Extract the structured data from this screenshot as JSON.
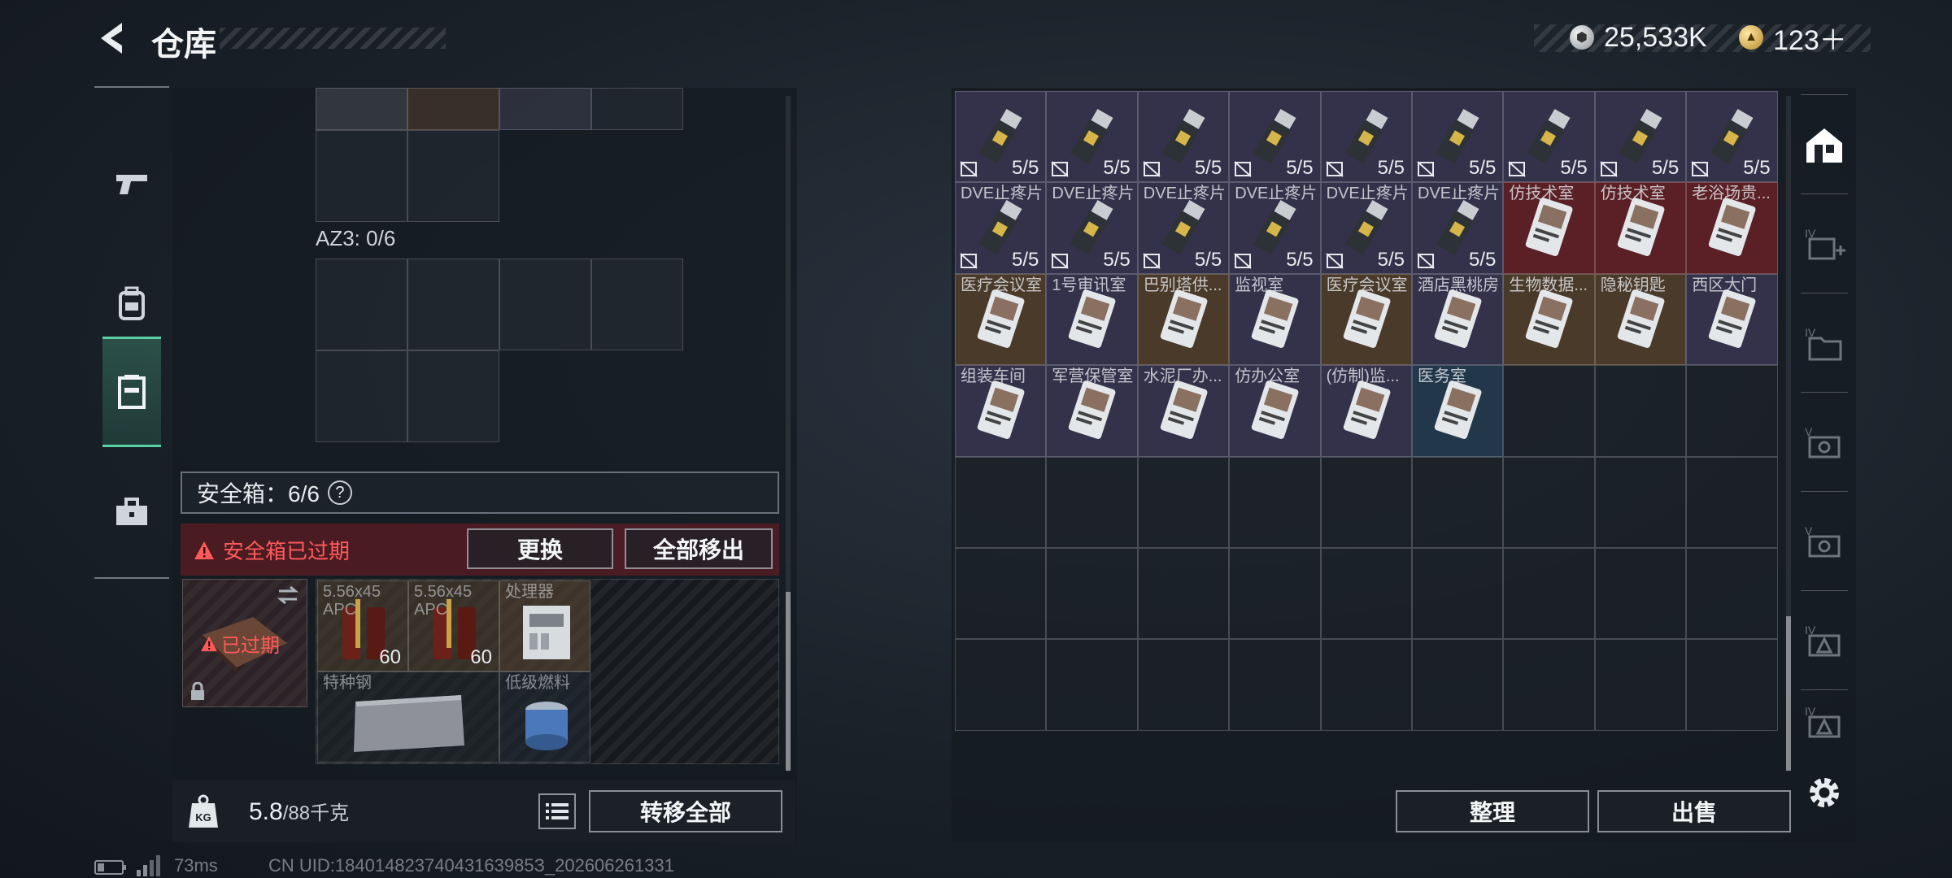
{
  "header": {
    "title": "仓库",
    "currency": [
      {
        "icon": "silver-coin-icon",
        "value": "25,533K"
      },
      {
        "icon": "gold-coin-icon",
        "value": "123＋"
      }
    ]
  },
  "left": {
    "az_label": "AZ3: 0/6",
    "safebox_label": "安全箱：6/6",
    "safebox_help": "?",
    "expired_notice": "安全箱已过期",
    "replace_button": "更换",
    "remove_all_button": "全部移出",
    "case_status": "已过期",
    "safe_items": [
      {
        "name": "5.56x45 APC",
        "qty": "60"
      },
      {
        "name": "5.56x45 APC",
        "qty": "60"
      },
      {
        "name": "处理器",
        "qty": ""
      },
      {
        "name": "特种钢",
        "qty": ""
      },
      {
        "name": "低级燃料",
        "qty": ""
      }
    ],
    "weight_value": "5.8",
    "weight_capacity": "/88千克",
    "weight_icon_label": "KG",
    "transfer_all_button": "转移全部"
  },
  "right": {
    "stack_items_row1": [
      "5/5",
      "5/5",
      "5/5",
      "5/5",
      "5/5",
      "5/5",
      "5/5",
      "5/5",
      "5/5"
    ],
    "stack_items_row2": [
      {
        "name": "DVE止疼片",
        "qty": "5/5"
      },
      {
        "name": "DVE止疼片",
        "qty": "5/5"
      },
      {
        "name": "DVE止疼片",
        "qty": "5/5"
      },
      {
        "name": "DVE止疼片",
        "qty": "5/5"
      },
      {
        "name": "DVE止疼片",
        "qty": "5/5"
      },
      {
        "name": "DVE止疼片",
        "qty": "5/5"
      },
      {
        "name": "仿技术室",
        "qty": ""
      },
      {
        "name": "仿技术室",
        "qty": ""
      },
      {
        "name": "老浴场贵...",
        "qty": ""
      }
    ],
    "key_row3": [
      "医疗会议室",
      "1号审讯室",
      "巴别塔供...",
      "监视室",
      "医疗会议室",
      "酒店黑桃房",
      "生物数据...",
      "隐秘钥匙",
      "西区大门"
    ],
    "key_row4": [
      "组装车间",
      "军营保管室",
      "水泥厂办...",
      "仿办公室",
      "(仿制)监...",
      "医务室"
    ],
    "sort_button": "整理",
    "sell_button": "出售"
  },
  "status_bar": {
    "ping": "73ms",
    "uid": "CN UID:18401482374043163985З_202606261331"
  },
  "colors": {
    "accent_green": "#59d0a3",
    "danger_red": "#ff5a5a",
    "rarity_red": "#5a2026",
    "rarity_orange": "#4a3a2a",
    "rarity_purple": "#34314a",
    "rarity_blue": "#22384a"
  }
}
